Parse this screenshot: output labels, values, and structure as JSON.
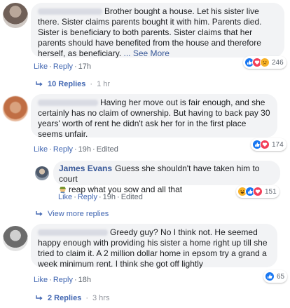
{
  "comments": [
    {
      "text": "Brother bought a house. Let his sister live there. Sister claims parents bought it with him. Parents died. Sister is beneficiary to both parents. Sister claims that her parents should have benefited from the house and therefore herself, as beneficiary.",
      "see_more": "... See More",
      "like": "Like",
      "reply": "Reply",
      "time": "17h",
      "reaction_count": "246",
      "replies_label": "10 Replies",
      "replies_time": "1 hr"
    },
    {
      "text": "Having her move out is fair enough, and she certainly has no claim of ownership. But having to back pay 30 years' worth of rent he didn't ask her for in the first place seems unfair.",
      "like": "Like",
      "reply": "Reply",
      "time": "19h",
      "edited": "Edited",
      "reaction_count": "174",
      "view_more": "View more replies"
    },
    {
      "author": "James Evans",
      "text": "Guess she shouldn't have taken him to court",
      "text2": "reap what you sow and all that",
      "like": "Like",
      "reply": "Reply",
      "time": "19h",
      "edited": "Edited",
      "reaction_count": "151"
    },
    {
      "text": "Greedy guy? No I think not. He seemed happy enough with providing his sister a home right up till she tried to claim it. A 2 million dollar home in epsom try a grand a week minimum rent. I think she got off lightly",
      "like": "Like",
      "reply": "Reply",
      "time": "18h",
      "reaction_count": "65",
      "replies_label": "2 Replies",
      "replies_time": "3 hrs"
    }
  ],
  "colors": {
    "link": "#4267b2",
    "bubble": "#f2f3f5",
    "like": "#1877f2",
    "love": "#f33e58",
    "haha": "#f7b125"
  }
}
